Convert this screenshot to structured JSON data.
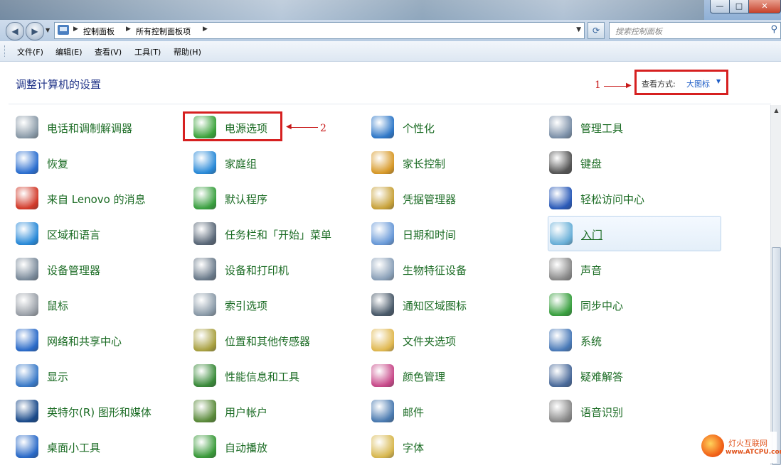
{
  "address": {
    "crumbs": [
      "控制面板",
      "所有控制面板项"
    ],
    "search_placeholder": "搜索控制面板"
  },
  "menu": [
    "文件(F)",
    "编辑(E)",
    "查看(V)",
    "工具(T)",
    "帮助(H)"
  ],
  "header": {
    "title": "调整计算机的设置",
    "view_by_label": "查看方式:",
    "view_by_value": "大图标"
  },
  "annotations": {
    "one": "1",
    "two": "2"
  },
  "items": [
    {
      "label": "电话和调制解调器",
      "icon": "phone-modem-icon",
      "color": "#8a9aa8"
    },
    {
      "label": "电源选项",
      "icon": "battery-icon",
      "color": "#3aa23a"
    },
    {
      "label": "个性化",
      "icon": "personalize-icon",
      "color": "#2f78c8"
    },
    {
      "label": "管理工具",
      "icon": "admin-tools-icon",
      "color": "#7c90a8"
    },
    {
      "label": "恢复",
      "icon": "recovery-icon",
      "color": "#2c6fd0"
    },
    {
      "label": "家庭组",
      "icon": "homegroup-icon",
      "color": "#2a8ad8"
    },
    {
      "label": "家长控制",
      "icon": "parental-control-icon",
      "color": "#d89a2a"
    },
    {
      "label": "键盘",
      "icon": "keyboard-icon",
      "color": "#555555"
    },
    {
      "label": "来自 Lenovo 的消息",
      "icon": "lenovo-message-icon",
      "color": "#d23a2a"
    },
    {
      "label": "默认程序",
      "icon": "default-programs-icon",
      "color": "#3aa040"
    },
    {
      "label": "凭据管理器",
      "icon": "credential-manager-icon",
      "color": "#c8a23a"
    },
    {
      "label": "轻松访问中心",
      "icon": "ease-of-access-icon",
      "color": "#2a5ab8"
    },
    {
      "label": "区域和语言",
      "icon": "region-language-icon",
      "color": "#2a8ad8"
    },
    {
      "label": "任务栏和「开始」菜单",
      "icon": "taskbar-icon",
      "color": "#5a6878"
    },
    {
      "label": "日期和时间",
      "icon": "date-time-icon",
      "color": "#6a9ad8"
    },
    {
      "label": "入门",
      "icon": "getting-started-icon",
      "color": "#6ab0d8"
    },
    {
      "label": "设备管理器",
      "icon": "device-manager-icon",
      "color": "#7a8a9a"
    },
    {
      "label": "设备和打印机",
      "icon": "devices-printers-icon",
      "color": "#6a7a8a"
    },
    {
      "label": "生物特征设备",
      "icon": "biometric-icon",
      "color": "#8aa0b8"
    },
    {
      "label": "声音",
      "icon": "speaker-icon",
      "color": "#8a8a8a"
    },
    {
      "label": "鼠标",
      "icon": "mouse-icon",
      "color": "#9aa0a8"
    },
    {
      "label": "索引选项",
      "icon": "indexing-icon",
      "color": "#8a9aa8"
    },
    {
      "label": "通知区域图标",
      "icon": "notification-icons-icon",
      "color": "#4a5a6a"
    },
    {
      "label": "同步中心",
      "icon": "sync-center-icon",
      "color": "#3aa040"
    },
    {
      "label": "网络和共享中心",
      "icon": "network-icon",
      "color": "#2a6ac8"
    },
    {
      "label": "位置和其他传感器",
      "icon": "location-sensor-icon",
      "color": "#a8a040"
    },
    {
      "label": "文件夹选项",
      "icon": "folder-options-icon",
      "color": "#e0b850"
    },
    {
      "label": "系统",
      "icon": "system-icon",
      "color": "#4a7ab8"
    },
    {
      "label": "显示",
      "icon": "display-icon",
      "color": "#3a7ac8"
    },
    {
      "label": "性能信息和工具",
      "icon": "performance-icon",
      "color": "#3a8a3a"
    },
    {
      "label": "颜色管理",
      "icon": "color-management-icon",
      "color": "#c84a8a"
    },
    {
      "label": "疑难解答",
      "icon": "troubleshooting-icon",
      "color": "#4a6a9a"
    },
    {
      "label": "英特尔(R) 图形和媒体",
      "icon": "intel-graphics-icon",
      "color": "#1a4a8a"
    },
    {
      "label": "用户帐户",
      "icon": "user-accounts-icon",
      "color": "#5a8a3a"
    },
    {
      "label": "邮件",
      "icon": "mail-icon",
      "color": "#4a7ab0"
    },
    {
      "label": "语音识别",
      "icon": "microphone-icon",
      "color": "#8a8a8a"
    },
    {
      "label": "桌面小工具",
      "icon": "gadgets-icon",
      "color": "#2a6ac8"
    },
    {
      "label": "自动播放",
      "icon": "autoplay-icon",
      "color": "#3a9a3a"
    },
    {
      "label": "字体",
      "icon": "fonts-icon",
      "color": "#d8b850"
    }
  ],
  "watermark": {
    "cn": "灯火互联网",
    "en": "www.ATCPU.com"
  }
}
